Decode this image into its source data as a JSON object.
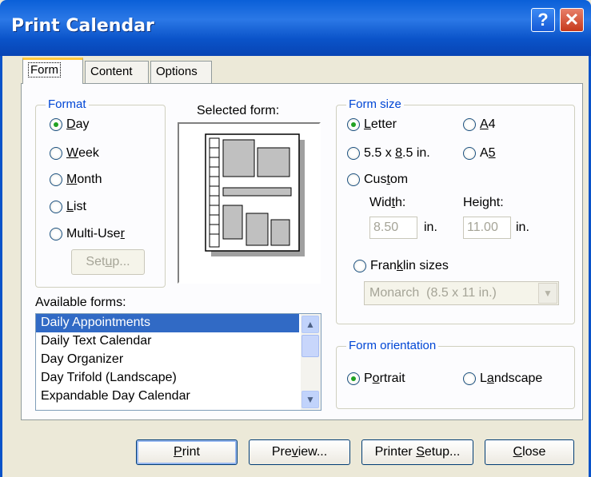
{
  "window": {
    "title": "Print Calendar",
    "help_label": "?",
    "close_label": "✕"
  },
  "tabs": [
    {
      "label": "Form",
      "active": true
    },
    {
      "label": "Content",
      "active": false
    },
    {
      "label": "Options",
      "active": false
    }
  ],
  "format": {
    "legend": "Format",
    "options": [
      {
        "pre": "",
        "key": "D",
        "post": "ay",
        "selected": true
      },
      {
        "pre": "",
        "key": "W",
        "post": "eek",
        "selected": false
      },
      {
        "pre": "",
        "key": "M",
        "post": "onth",
        "selected": false
      },
      {
        "pre": "",
        "key": "L",
        "post": "ist",
        "selected": false
      },
      {
        "pre": "Multi-Use",
        "key": "r",
        "post": "",
        "selected": false
      }
    ],
    "setup_pre": "Set",
    "setup_key": "u",
    "setup_post": "p..."
  },
  "selected_form_label": "Selected form:",
  "form_size": {
    "legend": "Form size",
    "letter": {
      "pre": "",
      "key": "L",
      "post": "etter",
      "selected": true
    },
    "a4": {
      "pre": "",
      "key": "A",
      "post": "4",
      "selected": false
    },
    "half": {
      "pre": "5.5 x ",
      "key": "8",
      "post": ".5 in.",
      "selected": false
    },
    "a5": {
      "pre": "A",
      "key": "5",
      "post": "",
      "selected": false
    },
    "custom": {
      "pre": "Cus",
      "key": "t",
      "post": "om",
      "selected": false
    },
    "width_pre": "Wid",
    "width_key": "t",
    "width_post": "h:",
    "height_label": "Height:",
    "width_value": "8.50",
    "height_value": "11.00",
    "unit": "in.",
    "franklin": {
      "pre": "Fran",
      "key": "k",
      "post": "lin sizes",
      "selected": false
    },
    "franklin_value": "Monarch  (8.5 x 11 in.)"
  },
  "available_forms": {
    "label": "Available forms:",
    "items": [
      "Daily Appointments",
      "Daily Text Calendar",
      "Day Organizer",
      "Day Trifold (Landscape)",
      "Expandable Day Calendar"
    ],
    "selected_index": 0
  },
  "orientation": {
    "legend": "Form orientation",
    "portrait": {
      "pre": "P",
      "key": "o",
      "post": "rtrait",
      "selected": true
    },
    "landscape": {
      "pre": "L",
      "key": "a",
      "post": "ndscape",
      "selected": false
    }
  },
  "buttons": {
    "print": {
      "pre": "",
      "key": "P",
      "post": "rint"
    },
    "preview": {
      "pre": "Pre",
      "key": "v",
      "post": "iew..."
    },
    "printer_setup": {
      "pre": "Printer ",
      "key": "S",
      "post": "etup..."
    },
    "close": {
      "pre": "",
      "key": "C",
      "post": "lose"
    }
  },
  "colors": {
    "title_bar": "#0a53c9",
    "dialog_bg": "#ece9d8",
    "legend": "#0046d5",
    "selection": "#316ac5"
  }
}
